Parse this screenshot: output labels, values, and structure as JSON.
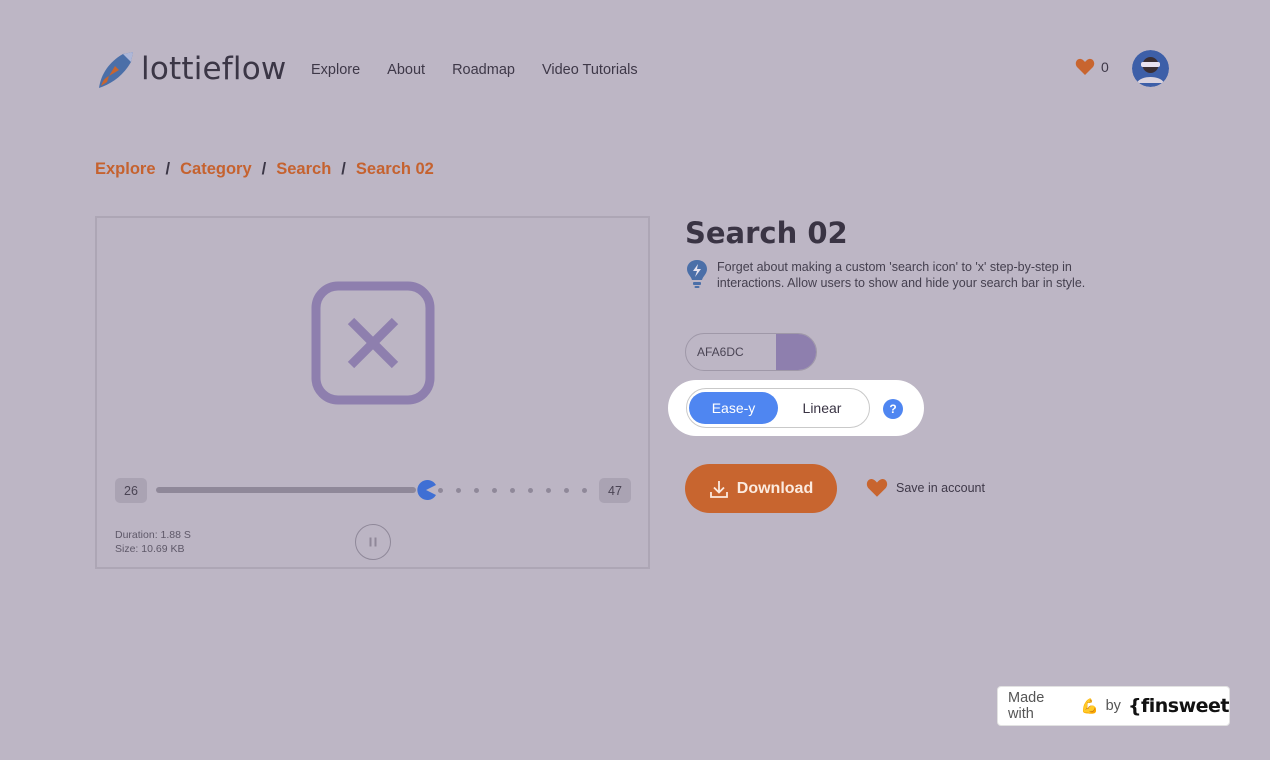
{
  "brand": {
    "name": "lottieflow"
  },
  "nav": {
    "items": [
      {
        "label": "Explore"
      },
      {
        "label": "About"
      },
      {
        "label": "Roadmap"
      },
      {
        "label": "Video Tutorials"
      }
    ]
  },
  "header": {
    "likes_count": "0"
  },
  "breadcrumb": {
    "items": [
      "Explore",
      "Category",
      "Search",
      "Search 02"
    ],
    "separator": "/"
  },
  "preview": {
    "frame_start": "26",
    "frame_end": "47",
    "progress_fraction": 0.6,
    "duration": "Duration: 1.88 S",
    "size": "Size: 10.69 KB",
    "icon": "close-x-icon"
  },
  "animation": {
    "title": "Search 02",
    "description": "Forget about making a custom 'search icon' to 'x' step-by-step in interactions. Allow users to show and hide your search bar in style."
  },
  "color": {
    "value": "AFA6DC",
    "swatch": "#8e7fae"
  },
  "easing": {
    "active": "Ease-y",
    "inactive": "Linear",
    "help": "?"
  },
  "actions": {
    "download": "Download",
    "save": "Save in account"
  },
  "badge": {
    "made_with": "Made with",
    "emoji": "💪",
    "by": "by",
    "brand": "{finsweet"
  },
  "colors": {
    "accent_orange": "#c8652f",
    "accent_blue": "#4f86f1",
    "background": "#bdb6c5",
    "icon_purple": "#8e7fae"
  }
}
